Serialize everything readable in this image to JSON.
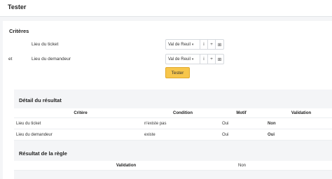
{
  "window": {
    "title": "Tester"
  },
  "criteria": {
    "title": "Critères",
    "prefix": "et",
    "rows": [
      {
        "label": "Lieu du ticket",
        "value": "Val de Reuil",
        "icons": [
          "info-icon",
          "plus-icon",
          "dropdown-icon"
        ]
      },
      {
        "label": "Lieu du demandeur",
        "value": "Val de Reuil",
        "icons": [
          "info-icon",
          "plus-icon",
          "dropdown-icon"
        ]
      }
    ],
    "glyphs": {
      "caret": "▾",
      "info": "i",
      "plus": "+",
      "dropdown": "⊞"
    },
    "test_button": "Tester"
  },
  "detail": {
    "title": "Détail du résultat",
    "headers": [
      "Critère",
      "Condition",
      "Motif",
      "Validation"
    ],
    "rows": [
      {
        "critere": "Lieu du ticket",
        "condition": "n'existe pas",
        "motif": "Oui",
        "validation": "Non"
      },
      {
        "critere": "Lieu du demandeur",
        "condition": "existe",
        "motif": "Oui",
        "validation": "Oui"
      }
    ]
  },
  "rule_result": {
    "title": "Résultat de la règle",
    "label": "Validation",
    "value": "Non"
  }
}
